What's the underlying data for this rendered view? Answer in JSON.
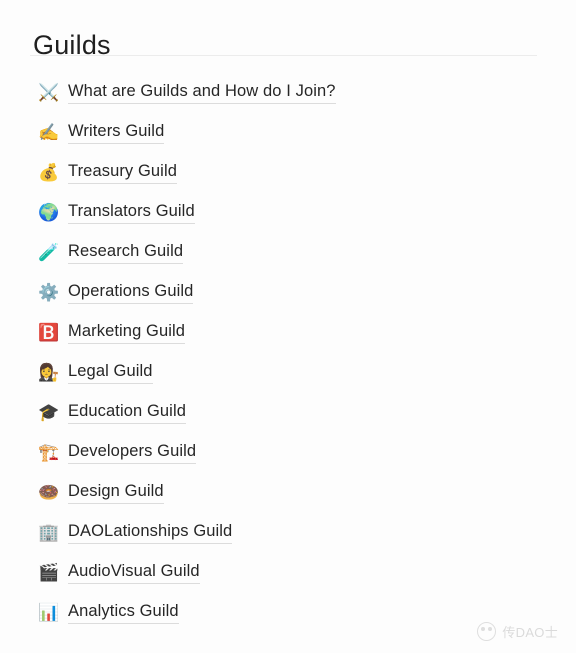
{
  "page": {
    "title": "Guilds",
    "background_color": "#fdfdfd",
    "text_color": "#262626",
    "divider_color": "#ececec",
    "link_underline_color": "#dcdcdc"
  },
  "guilds": [
    {
      "label": "What are Guilds and How do I Join?",
      "icon": "crossed-swords-icon",
      "glyph": "⚔️"
    },
    {
      "label": "Writers Guild",
      "icon": "writing-hand-icon",
      "glyph": "✍️"
    },
    {
      "label": "Treasury Guild",
      "icon": "money-bag-icon",
      "glyph": "💰"
    },
    {
      "label": "Translators Guild",
      "icon": "globe-icon",
      "glyph": "🌍"
    },
    {
      "label": "Research Guild",
      "icon": "test-tube-icon",
      "glyph": "🧪"
    },
    {
      "label": "Operations Guild",
      "icon": "gear-icon",
      "glyph": "⚙️"
    },
    {
      "label": "Marketing Guild",
      "icon": "brand-badge-icon",
      "glyph": "🅱️"
    },
    {
      "label": "Legal Guild",
      "icon": "judge-icon",
      "glyph": "👩‍⚖️"
    },
    {
      "label": "Education Guild",
      "icon": "graduation-cap-icon",
      "glyph": "🎓"
    },
    {
      "label": "Developers Guild",
      "icon": "construction-crane-icon",
      "glyph": "🏗️"
    },
    {
      "label": "Design Guild",
      "icon": "donut-icon",
      "glyph": "🍩"
    },
    {
      "label": "DAOLationships Guild",
      "icon": "cityscape-icon",
      "glyph": "🏢"
    },
    {
      "label": "AudioVisual Guild",
      "icon": "clapper-board-icon",
      "glyph": "🎬"
    },
    {
      "label": "Analytics Guild",
      "icon": "bar-chart-icon",
      "glyph": "📊"
    }
  ],
  "watermark": {
    "text": "传DAO士"
  }
}
